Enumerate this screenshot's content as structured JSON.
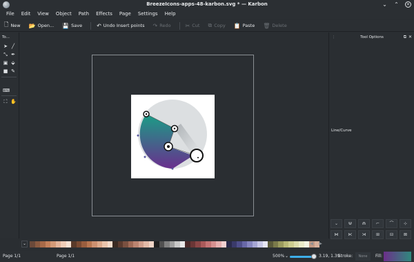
{
  "window": {
    "title": "BreezeIcons-apps-48-karbon.svg * — Karbon",
    "buttons": [
      "⌄",
      "⌃",
      "✕"
    ]
  },
  "menu": [
    "File",
    "Edit",
    "View",
    "Object",
    "Path",
    "Effects",
    "Page",
    "Settings",
    "Help"
  ],
  "toolbar": {
    "new": "New",
    "open": "Open...",
    "save": "Save",
    "undo": "Undo Insert points",
    "redo": "Redo",
    "cut": "Cut",
    "copy": "Copy",
    "paste": "Paste",
    "delete": "Delete"
  },
  "toolbox": {
    "title": "To..."
  },
  "panel": {
    "title": "Tool Options",
    "mode_label": "Line/Curve"
  },
  "palette": {
    "colors": [
      "#6b4a3a",
      "#8a5a40",
      "#a86a48",
      "#c4805a",
      "#d49a78",
      "#e3b49a",
      "#efcdb8",
      "#f6e2d4",
      "#5a3a2a",
      "#7a4a32",
      "#9a5e3e",
      "#b87650",
      "#cc9070",
      "#dcaa8c",
      "#eac4ac",
      "#f4dccc",
      "#3a2a22",
      "#5a3a2e",
      "#7a5040",
      "#a06a56",
      "#bb8470",
      "#d09e8c",
      "#e2baa8",
      "#f0d4c6",
      "#202020",
      "#505050",
      "#808080",
      "#a0a0a0",
      "#c8c8c8",
      "#e8e8e8",
      "#4a2a2a",
      "#6a3636",
      "#8a4646",
      "#aa5a5a",
      "#c47474",
      "#d69090",
      "#e6b0b0",
      "#f2d0d0",
      "#2a2a4a",
      "#3a3a6a",
      "#4e4e8a",
      "#6868a8",
      "#8686c0",
      "#a6a6d4",
      "#c8c8e6",
      "#e6e6f4",
      "#5a5a3a",
      "#7a7a4a",
      "#9a9a5e",
      "#b8b876",
      "#cccc90",
      "#dcdcac",
      "#eaeac8",
      "#f4f4e2",
      "#c49a86",
      "#d8b09c"
    ]
  },
  "status": {
    "page_left": "Page 1/1",
    "page_right": "Page 1/1",
    "zoom": "500%",
    "zoom_caret": "⌄",
    "coords": "3.19, 1.39",
    "stroke_label": "Stroke:",
    "stroke_value": "None",
    "fill_label": "Fill:"
  }
}
